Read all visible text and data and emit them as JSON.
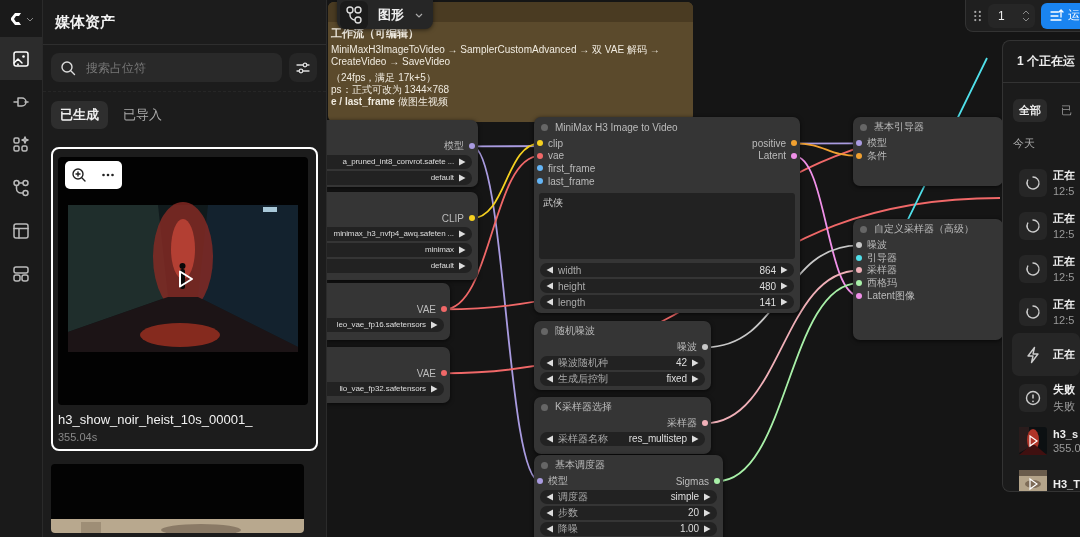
{
  "rail": {
    "items": [
      {
        "selected": true
      },
      {
        "selected": false
      },
      {
        "selected": false
      },
      {
        "selected": false
      },
      {
        "selected": false
      },
      {
        "selected": false
      }
    ]
  },
  "media_panel": {
    "title": "媒体资产",
    "search": {
      "placeholder": "搜索占位符"
    },
    "tabs": [
      {
        "label": "已生成",
        "selected": true
      },
      {
        "label": "已导入",
        "selected": false
      }
    ],
    "assets": [
      {
        "kind": "picture",
        "name": "h3_show_noir_heist_10s_00001_",
        "duration": "355.04s",
        "selected": true
      },
      {
        "kind": "picture"
      }
    ]
  },
  "canvas": {
    "graph_button": {
      "label": "图形"
    },
    "note": {
      "lines": [
        "工作流（可编辑）",
        "MiniMaxH3ImageToVideo → SamplerCustomAdvanced → 双 VAE 解码 → CreateVideo → SaveVideo",
        "（24fps，满足 17k+5）",
        "ps：正式可改为 1344×768",
        "**e / last_frame** 做图生视频"
      ]
    },
    "nodes": [
      {
        "outputs": [
          {
            "label": "模型",
            "color": "#a99be0"
          }
        ],
        "widgets": [
          {
            "value": "a_pruned_int8_convrot.safete ..."
          },
          {
            "value": "default"
          }
        ]
      },
      {
        "outputs": [
          {
            "label": "CLIP",
            "color": "#f5d020"
          }
        ],
        "widgets": [
          {
            "value": "minimax_h3_nvfp4_awq.safeten ..."
          },
          {
            "value": "minimax"
          },
          {
            "value": "default"
          }
        ]
      },
      {
        "outputs": [
          {
            "label": "VAE",
            "color": "#f06868"
          }
        ],
        "widgets": [
          {
            "value": "leo_vae_fp16.safetensors"
          }
        ]
      },
      {
        "outputs": [
          {
            "label": "VAE",
            "color": "#f06868"
          }
        ],
        "widgets": [
          {
            "value": "lio_vae_fp32.safetensors"
          }
        ]
      },
      {
        "title": "MiniMax H3 Image to Video",
        "inputs": [
          {
            "label": "clip",
            "color": "#f5d020"
          },
          {
            "label": "vae",
            "color": "#f06868"
          },
          {
            "label": "first_frame",
            "color": "#64b5f6"
          },
          {
            "label": "last_frame",
            "color": "#64b5f6"
          }
        ],
        "outputs": [
          {
            "label": "positive",
            "color": "#f0a030"
          },
          {
            "label": "Latent",
            "color": "#f090e8"
          }
        ],
        "prompt": "武侠",
        "widgets": [
          {
            "label": "width",
            "value": "864"
          },
          {
            "label": "height",
            "value": "480"
          },
          {
            "label": "length",
            "value": "141"
          }
        ]
      },
      {
        "title": "随机噪波",
        "outputs": [
          {
            "label": "噪波",
            "color": "#c8c8c8"
          }
        ],
        "widgets": [
          {
            "label": "噪波随机种",
            "value": "42"
          },
          {
            "label": "生成后控制",
            "value": "fixed"
          }
        ]
      },
      {
        "title": "K采样器选择",
        "outputs": [
          {
            "label": "采样器",
            "color": "#f0b0b8"
          }
        ],
        "widgets": [
          {
            "label": "采样器名称",
            "value": "res_multistep"
          }
        ]
      },
      {
        "title": "基本调度器",
        "inputs": [
          {
            "label": "模型",
            "color": "#a99be0"
          }
        ],
        "outputs": [
          {
            "label": "Sigmas",
            "color": "#a8f0a8"
          }
        ],
        "widgets": [
          {
            "label": "调度器",
            "value": "simple"
          },
          {
            "label": "步数",
            "value": "20"
          },
          {
            "label": "降噪",
            "value": "1.00"
          }
        ]
      },
      {
        "title": "基本引导器",
        "inputs": [
          {
            "label": "模型",
            "color": "#a99be0"
          },
          {
            "label": "条件",
            "color": "#f0a030"
          }
        ]
      },
      {
        "title": "自定义采样器（高级）",
        "inputs": [
          {
            "label": "噪波",
            "color": "#c8c8c8"
          },
          {
            "label": "引导器",
            "color": "#50e0ea"
          },
          {
            "label": "采样器",
            "color": "#f0b0b8"
          },
          {
            "label": "西格玛",
            "color": "#a8f0a8"
          },
          {
            "label": "Latent图像",
            "color": "#f090e8"
          }
        ]
      }
    ],
    "run_controls": {
      "batch_count": "1",
      "run_label": "运"
    },
    "queue": {
      "title": "1 个正在运",
      "tabs": [
        {
          "label": "全部",
          "selected": true
        },
        {
          "label": "已",
          "selected": false
        }
      ],
      "section": "今天",
      "items": [
        {
          "kind": "pending",
          "title": "正在",
          "time": "12:5"
        },
        {
          "kind": "pending",
          "title": "正在",
          "time": "12:5"
        },
        {
          "kind": "pending",
          "title": "正在",
          "time": "12:5"
        },
        {
          "kind": "pending",
          "title": "正在",
          "time": "12:5"
        },
        {
          "kind": "running",
          "title": "正在"
        },
        {
          "kind": "failed",
          "title": "失败",
          "time": "失败"
        },
        {
          "kind": "asset",
          "title": "h3_s",
          "time": "355.0"
        },
        {
          "kind": "asset_light",
          "title": "H3_T"
        }
      ]
    }
  }
}
